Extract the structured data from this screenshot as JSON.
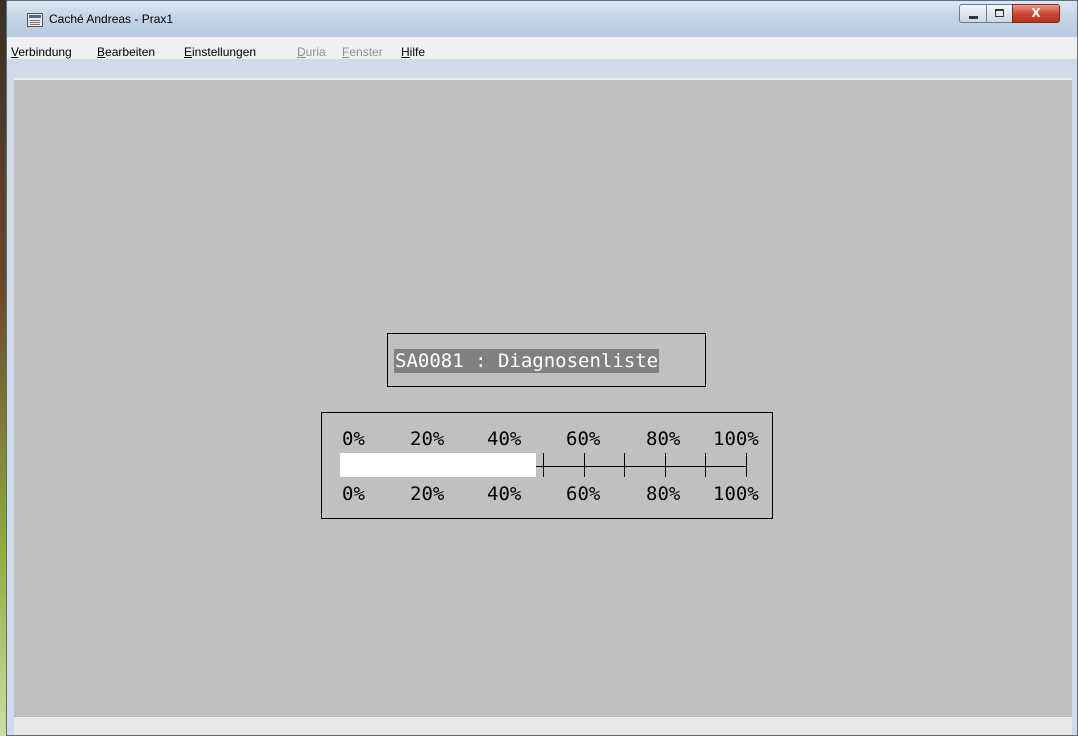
{
  "window": {
    "title": "Caché Andreas - Prax1",
    "controls": {
      "minimize": "–",
      "maximize": "□",
      "close": "X"
    }
  },
  "menu": [
    {
      "label": "Verbindung",
      "accel": "V",
      "rest": "erbindung",
      "enabled": true
    },
    {
      "label": "Bearbeiten",
      "accel": "B",
      "rest": "earbeiten",
      "enabled": true
    },
    {
      "label": "Einstellungen",
      "accel": "E",
      "rest": "instellungen",
      "enabled": true
    },
    {
      "label": "Duria",
      "accel": "D",
      "rest": "uria",
      "enabled": false
    },
    {
      "label": "Fenster",
      "accel": "F",
      "rest": "enster",
      "enabled": false
    },
    {
      "label": "Hilfe",
      "accel": "H",
      "rest": "ilfe",
      "enabled": true
    }
  ],
  "terminal": {
    "header": "SA0081 : Diagnosenliste",
    "progress": {
      "labels_top": [
        "0%",
        "20%",
        "40%",
        "60%",
        "80%",
        "100%"
      ],
      "labels_bottom": [
        "0%",
        "20%",
        "40%",
        "60%",
        "80%",
        "100%"
      ],
      "fill_fraction": 0.48
    }
  },
  "colors": {
    "terminal_background": "#c0c0c0",
    "header_highlight": "#808080",
    "progress_fill": "#ffffff"
  }
}
